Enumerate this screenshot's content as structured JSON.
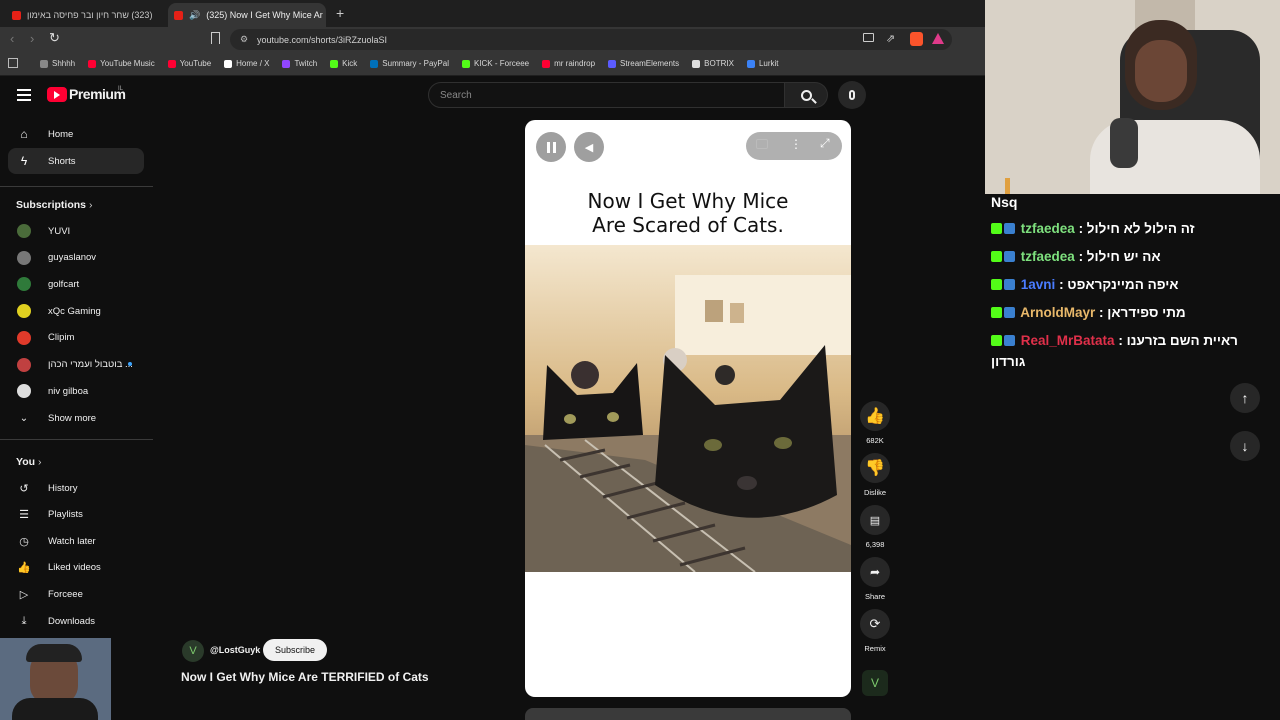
{
  "browser": {
    "tabs": [
      {
        "label": "(323) שחר חיון ובר פחיסה באימון"
      },
      {
        "label": "(325) Now I Get Why Mice Ar"
      }
    ],
    "url": "youtube.com/shorts/3iRZzuolaSI",
    "bookmarks": [
      {
        "label": "Shhhh",
        "color": "#888888"
      },
      {
        "label": "YouTube Music",
        "color": "#ff0033"
      },
      {
        "label": "YouTube",
        "color": "#ff0033"
      },
      {
        "label": "Home / X",
        "color": "#ffffff"
      },
      {
        "label": "Twitch",
        "color": "#9146ff"
      },
      {
        "label": "Kick",
        "color": "#53fc18"
      },
      {
        "label": "Summary - PayPal",
        "color": "#0070ba"
      },
      {
        "label": "KICK - Forceee",
        "color": "#53fc18"
      },
      {
        "label": "mr raindrop",
        "color": "#ff0033"
      },
      {
        "label": "StreamElements",
        "color": "#5b5bff"
      },
      {
        "label": "BOTRIX",
        "color": "#dddddd"
      },
      {
        "label": "Lurkit",
        "color": "#3b82f6"
      }
    ]
  },
  "youtube": {
    "logo_text": "Premium",
    "logo_region": "IL",
    "search_placeholder": "Search",
    "nav": [
      {
        "label": "Home",
        "icon": "home-icon"
      },
      {
        "label": "Shorts",
        "icon": "shorts-icon"
      }
    ],
    "subscriptions_heading": "Subscriptions",
    "subscriptions": [
      {
        "label": "YUVI",
        "color": "#4a6b3a"
      },
      {
        "label": "guyaslanov",
        "color": "#777777"
      },
      {
        "label": "golfcart",
        "color": "#2f7a3a"
      },
      {
        "label": "xQc Gaming",
        "color": "#e0d020"
      },
      {
        "label": "Clipim",
        "color": "#e03a2a"
      },
      {
        "label": "בוטבול ועמרי הכהן ...",
        "color": "#c04040"
      },
      {
        "label": "niv gilboa",
        "color": "#dddddd"
      }
    ],
    "show_more": "Show more",
    "you_heading": "You",
    "you_items": [
      {
        "label": "History",
        "icon": "history-icon"
      },
      {
        "label": "Playlists",
        "icon": "playlists-icon"
      },
      {
        "label": "Watch later",
        "icon": "watch-later-icon"
      },
      {
        "label": "Liked videos",
        "icon": "liked-videos-icon"
      },
      {
        "label": "Forceee",
        "icon": "forceee-icon"
      },
      {
        "label": "Downloads",
        "icon": "downloads-icon"
      }
    ],
    "short": {
      "overlay_title_line1": "Now I Get Why Mice",
      "overlay_title_line2": "Are Scared of Cats.",
      "channel": "@LostGuyk",
      "subscribe_label": "Subscribe",
      "video_title": "Now I Get Why Mice Are TERRIFIED of Cats",
      "likes": "682K",
      "dislike_label": "Dislike",
      "comments": "6,398",
      "share_label": "Share",
      "remix_label": "Remix"
    }
  },
  "chat": {
    "streamer": "Nsq",
    "messages": [
      {
        "user": "tzfaedea",
        "user_color": "#7ee07e",
        "text": "זה הילול לא חילול :"
      },
      {
        "user": "tzfaedea",
        "user_color": "#7ee07e",
        "text": "אה יש חילול :"
      },
      {
        "user": "1avni",
        "user_color": "#4a7cff",
        "text": "איפה המיינקראפט :"
      },
      {
        "user": "ArnoldMayr",
        "user_color": "#e8b86a",
        "text": "מתי ספידראן :"
      },
      {
        "user": "Real_MrBatata",
        "user_color": "#e0304a",
        "text": "ראיית השם בזרענו :",
        "text2": "גורדון"
      }
    ]
  }
}
